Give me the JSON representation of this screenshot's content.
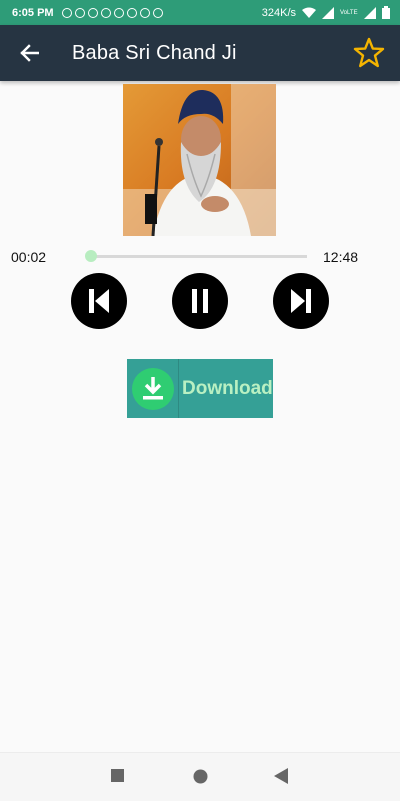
{
  "status_bar": {
    "time": "6:05 PM",
    "speed": "324K/s",
    "network_label": "VoLTE",
    "notification_icons": [
      "v-icon",
      "avatar-icon",
      "ghost-icon",
      "telegram-icon",
      "whatsapp-icon",
      "chat-icon",
      "calendar-icon",
      "chrome-icon",
      "whatsapp-icon"
    ]
  },
  "app_bar": {
    "title": "Baba Sri Chand Ji",
    "back_icon": "arrow-left-icon",
    "favorite_icon": "star-outline-icon",
    "background": "#263442",
    "star_color": "#f4b400"
  },
  "player": {
    "current_time": "00:02",
    "total_time": "12:48",
    "progress": 0.003,
    "controls": [
      "skip-previous-icon",
      "pause-icon",
      "skip-next-icon"
    ]
  },
  "download": {
    "label": "Download",
    "icon": "download-icon"
  },
  "nav_bar": {
    "buttons": [
      "recents-square-icon",
      "home-circle-icon",
      "back-triangle-icon"
    ]
  }
}
